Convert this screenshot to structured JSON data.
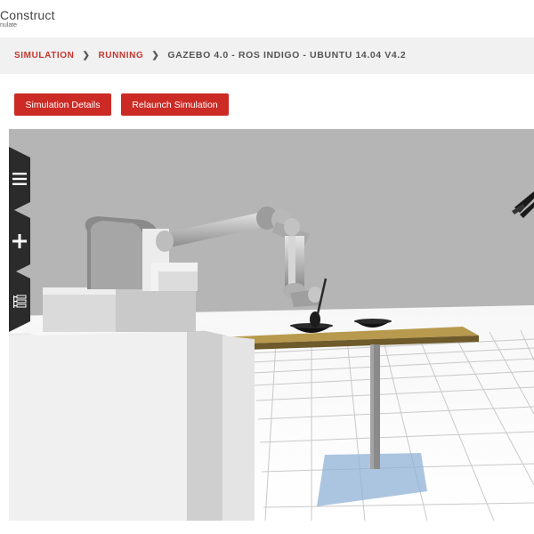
{
  "brand": {
    "name": "Construct",
    "tagline": "nulate"
  },
  "breadcrumb": {
    "items": [
      {
        "label": "SIMULATION"
      },
      {
        "label": "RUNNING"
      }
    ],
    "current": "GAZEBO 4.0 - ROS INDIGO - UBUNTU 14.04 V4.2"
  },
  "actions": {
    "details_label": "Simulation Details",
    "relaunch_label": "Relaunch Simulation"
  },
  "toolbar": {
    "icons": [
      "menu-icon",
      "plus-icon",
      "layers-tree-icon"
    ]
  },
  "colors": {
    "accent": "#cc2a24",
    "link": "#c8352e",
    "crumb_bar": "#f1f1f1",
    "viewport_sky": "#b5b5b5",
    "toolbar_bg": "#2b2b2b"
  }
}
